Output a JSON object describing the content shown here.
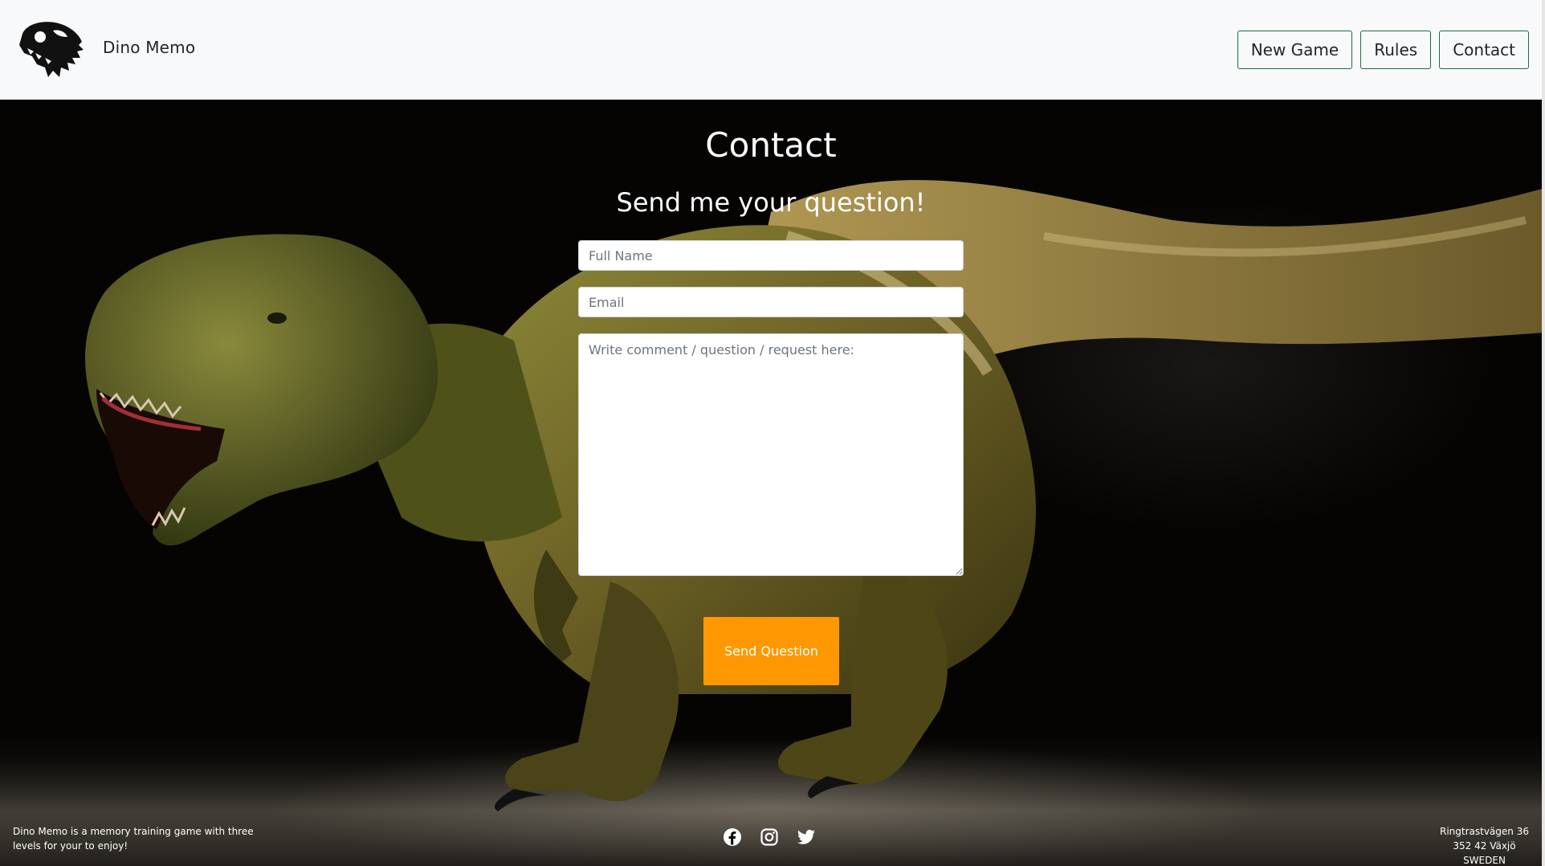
{
  "header": {
    "brand": "Dino Memo",
    "nav": [
      "New Game",
      "Rules",
      "Contact"
    ]
  },
  "main": {
    "title": "Contact",
    "subtitle": "Send me your question!",
    "fields": {
      "name_placeholder": "Full Name",
      "email_placeholder": "Email",
      "message_placeholder": "Write comment / question / request here:"
    },
    "send_label": "Send Question"
  },
  "footer": {
    "about": "Dino Memo is a memory training game with three levels for your to enjoy!",
    "address": [
      "Ringtrastvägen 36",
      "352 42 Växjö",
      "SWEDEN"
    ],
    "social_icons": [
      "facebook-icon",
      "instagram-icon",
      "twitter-icon"
    ]
  },
  "colors": {
    "header_bg": "#f8f9fa",
    "nav_border": "#1f6b45",
    "accent": "#ff9800",
    "page_bg": "#000000"
  }
}
